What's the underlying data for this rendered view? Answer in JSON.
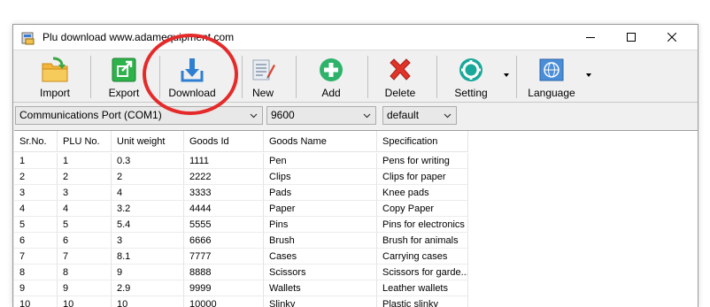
{
  "window": {
    "title": "Plu download www.adamequipment.com"
  },
  "toolbar": {
    "import_label": "Import",
    "export_label": "Export",
    "download_label": "Download",
    "new_label": "New",
    "add_label": "Add",
    "delete_label": "Delete",
    "setting_label": "Setting",
    "language_label": "Language"
  },
  "controls": {
    "port_value": "Communications Port (COM1)",
    "baud_value": "9600",
    "profile_value": "default"
  },
  "table": {
    "headers": [
      "Sr.No.",
      "PLU No.",
      "Unit weight",
      "Goods Id",
      "Goods Name",
      "Specification"
    ],
    "rows": [
      [
        "1",
        "1",
        "0.3",
        "1111",
        "Pen",
        "Pens for writing"
      ],
      [
        "2",
        "2",
        "2",
        "2222",
        "Clips",
        "Clips for paper"
      ],
      [
        "3",
        "3",
        "4",
        "3333",
        "Pads",
        "Knee pads"
      ],
      [
        "4",
        "4",
        "3.2",
        "4444",
        "Paper",
        "Copy Paper"
      ],
      [
        "5",
        "5",
        "5.4",
        "5555",
        "Pins",
        "Pins for electronics"
      ],
      [
        "6",
        "6",
        "3",
        "6666",
        "Brush",
        "Brush for animals"
      ],
      [
        "7",
        "7",
        "8.1",
        "7777",
        "Cases",
        "Carrying cases"
      ],
      [
        "8",
        "8",
        "9",
        "8888",
        "Scissors",
        "Scissors for garde..."
      ],
      [
        "9",
        "9",
        "2.9",
        "9999",
        "Wallets",
        "Leather wallets"
      ],
      [
        "10",
        "10",
        "10",
        "10000",
        "Slinky",
        "Plastic slinky"
      ]
    ]
  },
  "icons": {
    "app": "app-icon",
    "import": "folder-arrow-icon",
    "export": "export-arrow-icon",
    "download": "download-arrow-icon",
    "new": "new-document-icon",
    "add": "plus-circle-icon",
    "delete": "red-x-icon",
    "setting": "gear-icon",
    "language": "globe-icon"
  },
  "colors": {
    "annotation": "#e52a2a",
    "download_icon": "#2e7fd1",
    "add_icon": "#2fb36b",
    "setting_icon": "#1aa89a",
    "export_icon": "#2db34a"
  }
}
